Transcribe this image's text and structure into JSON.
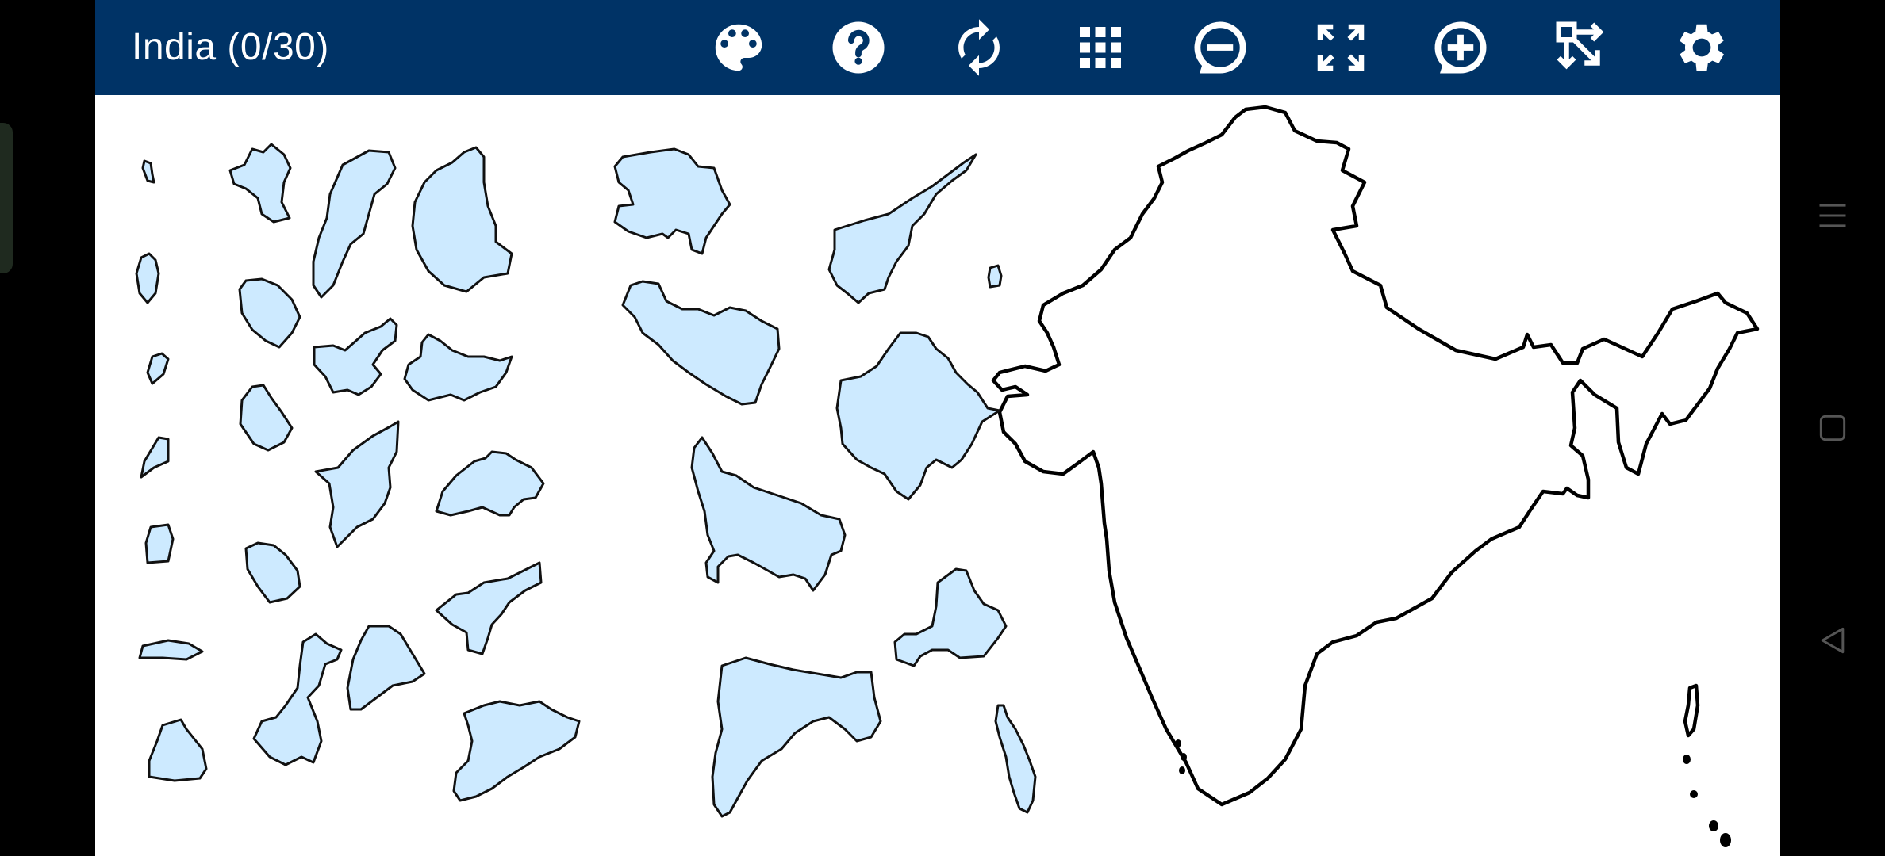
{
  "header": {
    "title": "India (0/30)"
  },
  "toolbar": [
    {
      "name": "palette-button",
      "icon": "palette-icon"
    },
    {
      "name": "help-button",
      "icon": "help-icon"
    },
    {
      "name": "restart-button",
      "icon": "restart-icon"
    },
    {
      "name": "grid-button",
      "icon": "grid-icon"
    },
    {
      "name": "zoom-out-button",
      "icon": "zoom-out-icon"
    },
    {
      "name": "fit-screen-button",
      "icon": "fullscreen-icon"
    },
    {
      "name": "zoom-in-button",
      "icon": "zoom-in-icon"
    },
    {
      "name": "arrange-button",
      "icon": "scatter-icon"
    },
    {
      "name": "settings-button",
      "icon": "gear-icon"
    }
  ],
  "puzzle": {
    "placed": 0,
    "total": 30,
    "piece_color": "#cdeaff",
    "header_color": "#003366"
  },
  "system_nav": [
    {
      "name": "recents-button",
      "icon": "menu-icon"
    },
    {
      "name": "home-button",
      "icon": "square-icon"
    },
    {
      "name": "back-button",
      "icon": "back-triangle-icon"
    }
  ]
}
